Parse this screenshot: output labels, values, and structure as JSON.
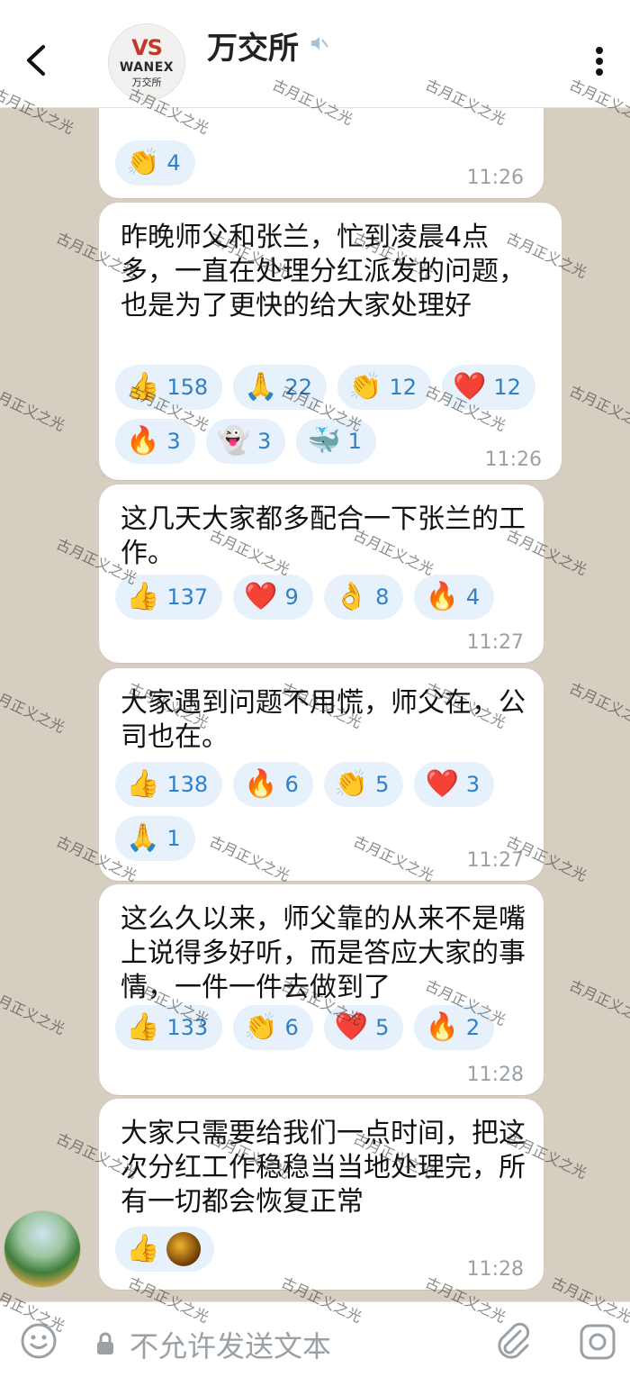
{
  "header": {
    "title": "万交所",
    "logo_mark": "VS",
    "logo_en": "WANEX",
    "logo_cn": "万交所"
  },
  "messages": [
    {
      "text": "",
      "reactions": [
        {
          "emoji": "👏",
          "count": "4"
        }
      ],
      "time": "11:26"
    },
    {
      "text": "昨晚师父和张兰，忙到凌晨4点多，一直在处理分红派发的问题，也是为了更快的给大家处理好",
      "reactions": [
        {
          "emoji": "👍",
          "count": "158"
        },
        {
          "emoji": "🙏",
          "count": "22"
        },
        {
          "emoji": "👏",
          "count": "12"
        },
        {
          "emoji": "❤️",
          "count": "12"
        },
        {
          "emoji": "🔥",
          "count": "3"
        },
        {
          "emoji": "👻",
          "count": "3"
        },
        {
          "emoji": "🐳",
          "count": "1"
        }
      ],
      "time": "11:26"
    },
    {
      "text": "这几天大家都多配合一下张兰的工作。",
      "reactions": [
        {
          "emoji": "👍",
          "count": "137"
        },
        {
          "emoji": "❤️",
          "count": "9"
        },
        {
          "emoji": "👌",
          "count": "8"
        },
        {
          "emoji": "🔥",
          "count": "4"
        }
      ],
      "time": "11:27"
    },
    {
      "text": "大家遇到问题不用慌，师父在，公司也在。",
      "reactions": [
        {
          "emoji": "👍",
          "count": "138"
        },
        {
          "emoji": "🔥",
          "count": "6"
        },
        {
          "emoji": "👏",
          "count": "5"
        },
        {
          "emoji": "❤️",
          "count": "3"
        },
        {
          "emoji": "🙏",
          "count": "1"
        }
      ],
      "time": "11:27"
    },
    {
      "text": "这么久以来，师父靠的从来不是嘴上说得多好听，而是答应大家的事情，一件一件去做到了",
      "reactions": [
        {
          "emoji": "👍",
          "count": "133"
        },
        {
          "emoji": "👏",
          "count": "6"
        },
        {
          "emoji": "❤️",
          "count": "5"
        },
        {
          "emoji": "🔥",
          "count": "2"
        }
      ],
      "time": "11:28"
    },
    {
      "text": "大家只需要给我们一点时间，把这次分红工作稳稳当当地处理完，所有一切都会恢复正常",
      "reactions": [
        {
          "emoji": "👍",
          "count": ""
        }
      ],
      "time": "11:28"
    }
  ],
  "footer": {
    "placeholder": "不允许发送文本"
  },
  "watermark": "古月正义之光"
}
